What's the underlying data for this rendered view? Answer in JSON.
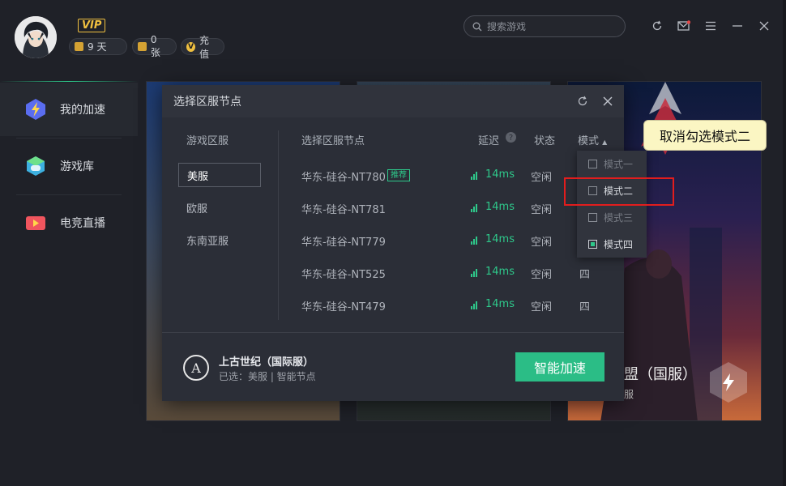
{
  "user": {
    "vip_badge": "VIP",
    "days": "9 天",
    "cards": "0 张",
    "recharge": "充值",
    "coin_symbol": "V"
  },
  "search": {
    "placeholder": "搜索游戏"
  },
  "sidebar": {
    "items": [
      {
        "label": "我的加速",
        "icon": "lightning-icon",
        "active": true
      },
      {
        "label": "游戏库",
        "icon": "game-library-icon",
        "active": false
      },
      {
        "label": "电竞直播",
        "icon": "live-video-icon",
        "active": false
      }
    ]
  },
  "background_cards": {
    "card3": {
      "title": "盟（国服）",
      "subtitle": "服"
    }
  },
  "dialog": {
    "title": "选择区服节点",
    "region_header": "游戏区服",
    "node_header": "选择区服节点",
    "latency_header": "延迟",
    "status_header": "状态",
    "mode_header": "模式",
    "regions": [
      {
        "label": "美服",
        "selected": true
      },
      {
        "label": "欧服",
        "selected": false
      },
      {
        "label": "东南亚服",
        "selected": false
      }
    ],
    "nodes": [
      {
        "name": "华东-硅谷-NT780",
        "tag": "推荐",
        "latency": "14ms",
        "status": "空闲",
        "mode": ""
      },
      {
        "name": "华东-硅谷-NT781",
        "tag": "",
        "latency": "14ms",
        "status": "空闲",
        "mode": ""
      },
      {
        "name": "华东-硅谷-NT779",
        "tag": "",
        "latency": "14ms",
        "status": "空闲",
        "mode": ""
      },
      {
        "name": "华东-硅谷-NT525",
        "tag": "",
        "latency": "14ms",
        "status": "空闲",
        "mode": "四"
      },
      {
        "name": "华东-硅谷-NT479",
        "tag": "",
        "latency": "14ms",
        "status": "空闲",
        "mode": "四"
      }
    ],
    "footer": {
      "game_name": "上古世纪（国际服）",
      "selection": "已选：美服 | 智能节点",
      "button": "智能加速"
    }
  },
  "mode_menu": {
    "items": [
      {
        "label": "模式一",
        "checked": false,
        "enabled": false
      },
      {
        "label": "模式二",
        "checked": false,
        "enabled": true
      },
      {
        "label": "模式三",
        "checked": false,
        "enabled": false
      },
      {
        "label": "模式四",
        "checked": true,
        "enabled": true
      }
    ]
  },
  "annotation": {
    "callout": "取消勾选模式二"
  },
  "colors": {
    "accent_green": "#2ec98b",
    "button_green": "#2bbd86",
    "highlight_red": "#e21d1d",
    "vip_gold": "#f0c040"
  }
}
